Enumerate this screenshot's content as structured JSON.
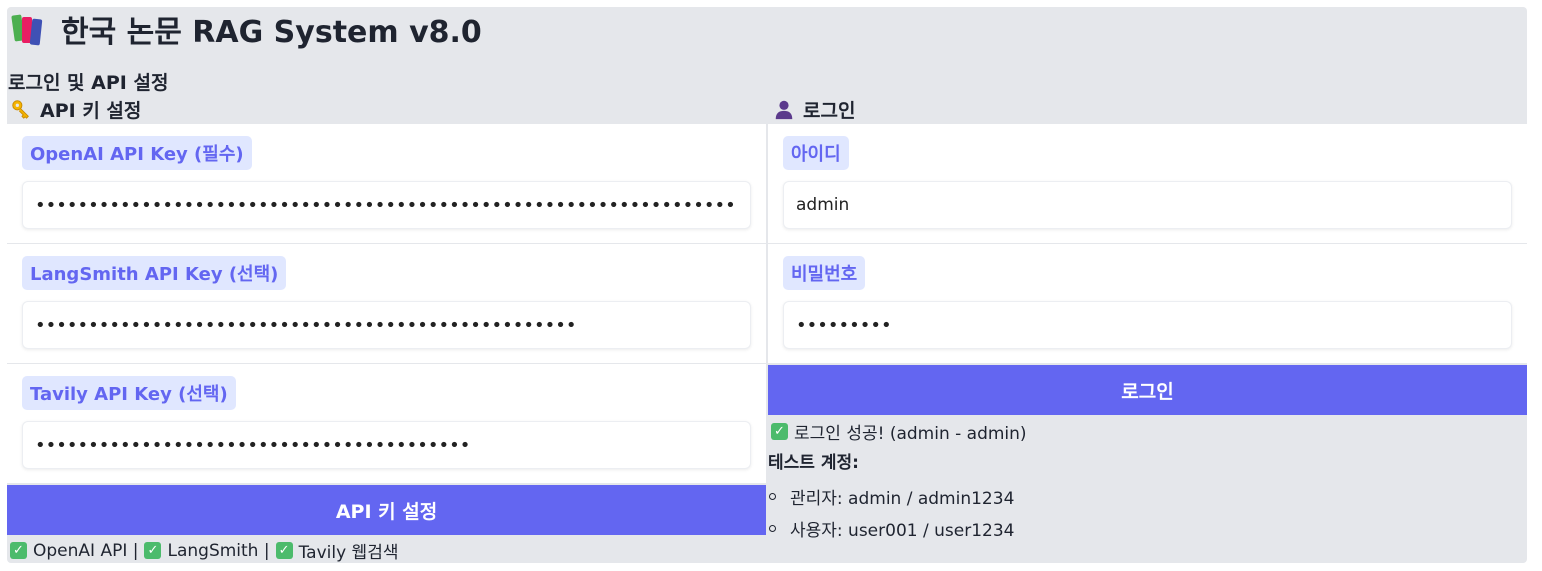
{
  "app": {
    "title": "한국 논문 RAG System v8.0",
    "title_icon": "books-icon"
  },
  "section": {
    "label": "로그인 및 API 설정"
  },
  "api_panel": {
    "header": "API 키 설정",
    "header_icon": "key-icon",
    "fields": [
      {
        "label": "OpenAI API Key (필수)",
        "value": "••••••••••••••••••••••••••••••••••••••••••••••••••••••••••••••••••••••••••••••••••••••••••••••••••••••••••••••••••••••••••••••••••••••••••••••••"
      },
      {
        "label": "LangSmith API Key (선택)",
        "value": "•••••••••••••••••••••••••••••••••••••••••••••••••••"
      },
      {
        "label": "Tavily API Key (선택)",
        "value": "•••••••••••••••••••••••••••••••••••••••••"
      }
    ],
    "submit_label": "API 키 설정",
    "status": {
      "openai": "OpenAI API |",
      "langsmith": "LangSmith |",
      "tavily": "Tavily 웹검색"
    }
  },
  "login_panel": {
    "header": "로그인",
    "header_icon": "user-icon",
    "username": {
      "label": "아이디",
      "value": "admin"
    },
    "password": {
      "label": "비밀번호",
      "value": "•••••••••"
    },
    "submit_label": "로그인",
    "result": "로그인 성공! (admin - admin)",
    "test_accounts_title": "테스트 계정:",
    "test_accounts": [
      "관리자: admin / admin1234",
      "사용자: user001 / user1234"
    ]
  },
  "colors": {
    "accent": "#6366f1",
    "label_bg": "#e0e7ff",
    "panel_bg": "#e5e7eb",
    "success": "#4cbb6c"
  }
}
